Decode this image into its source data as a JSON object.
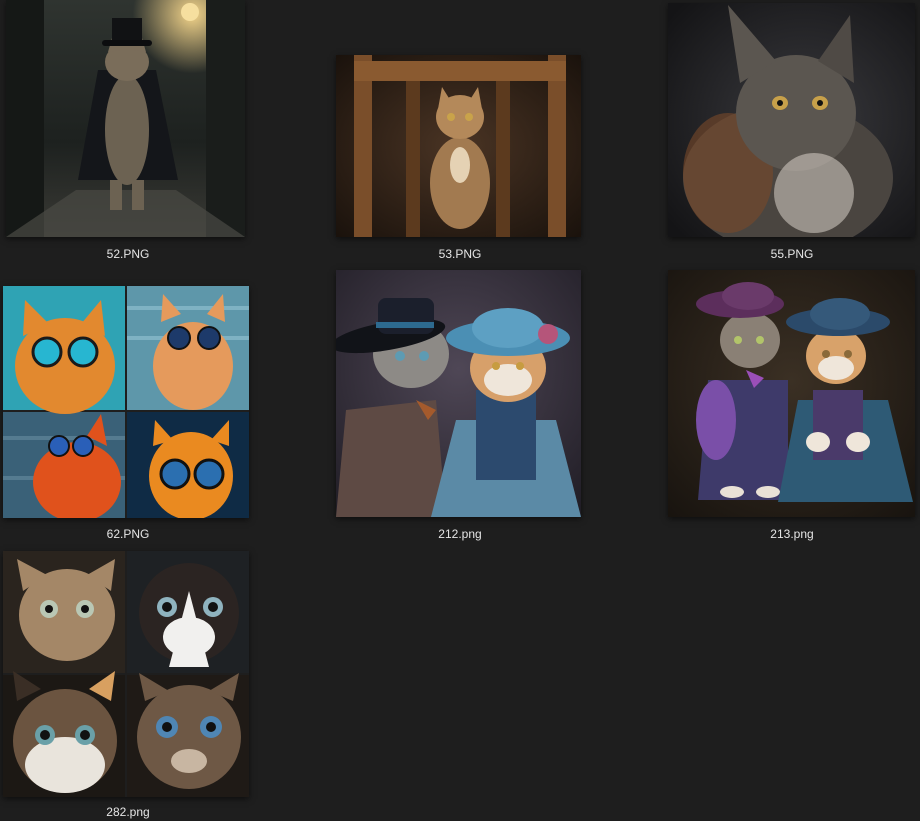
{
  "files": [
    {
      "name": "52.PNG",
      "thumbnail": "cat in top hat and cloak standing in a dark rainy alley"
    },
    {
      "name": "53.PNG",
      "thumbnail": "tabby kitten sitting on a wooden chair"
    },
    {
      "name": "55.PNG",
      "thumbnail": "long-haired grey cat portrait on dark background"
    },
    {
      "name": "62.PNG",
      "thumbnail": "four orange cats wearing blue round sunglasses"
    },
    {
      "name": "212.png",
      "thumbnail": "two cats dressed in victorian hats and clothing"
    },
    {
      "name": "213.png",
      "thumbnail": "two cats in purple and blue period costumes"
    },
    {
      "name": "282.png",
      "thumbnail": "four wide-eyed kittens collage"
    }
  ]
}
